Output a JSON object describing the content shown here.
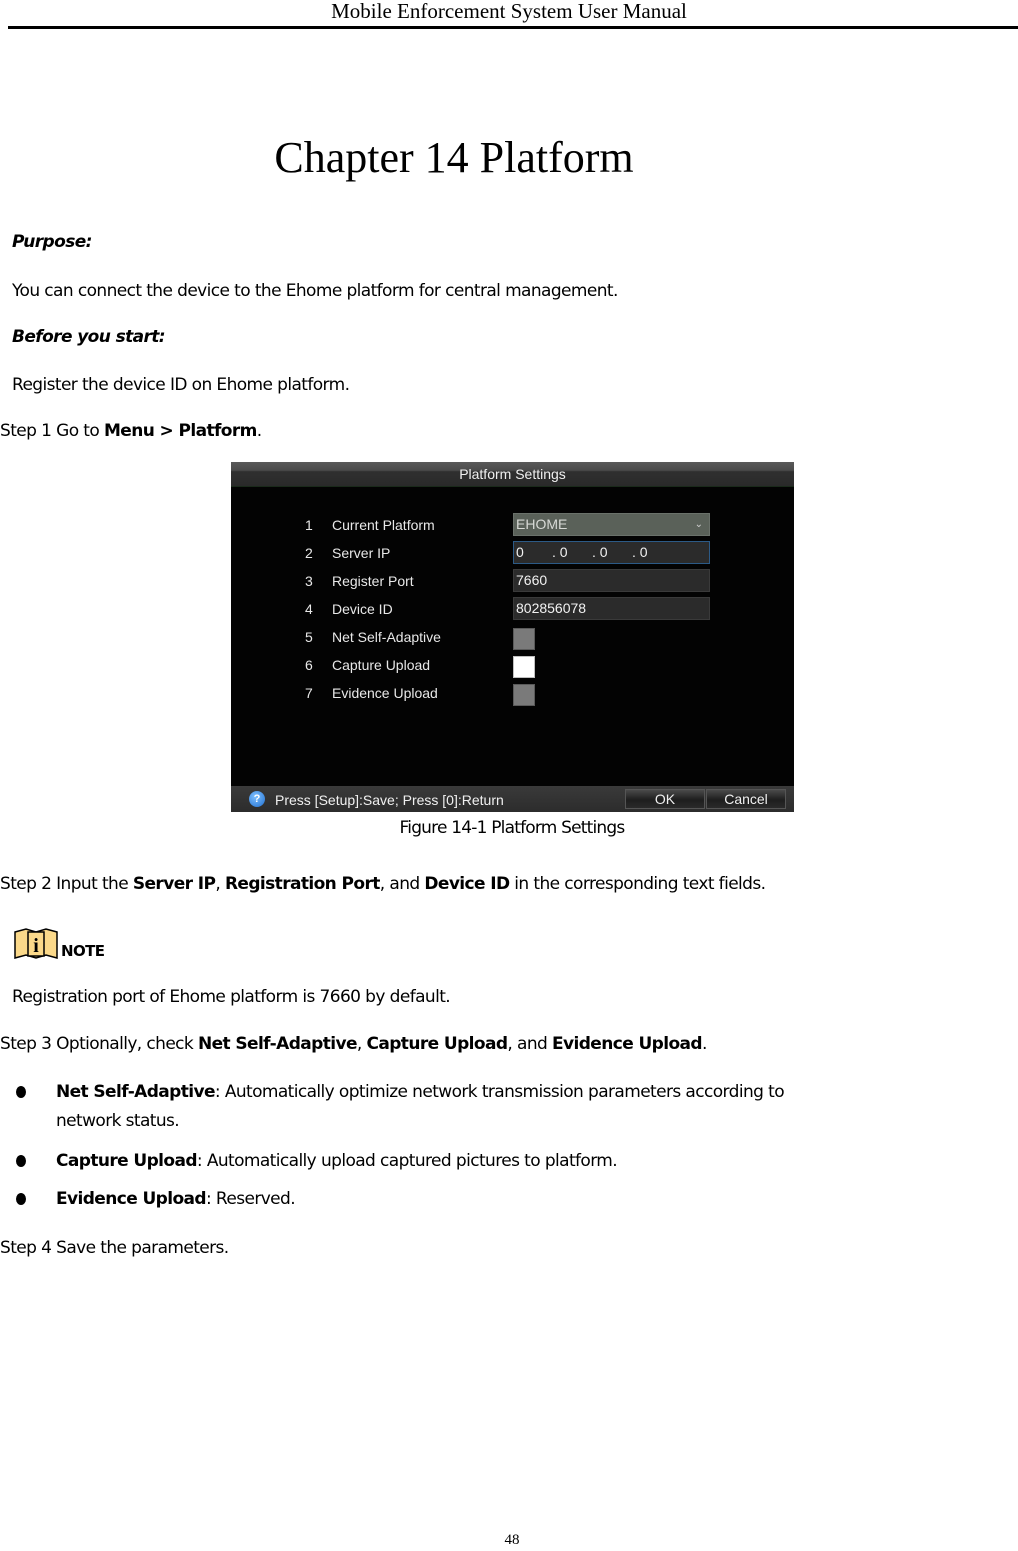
{
  "header": {
    "running_title": "Mobile Enforcement System User Manual"
  },
  "chapter": {
    "title": "Chapter 14 Platform"
  },
  "purpose": {
    "heading": "Purpose:",
    "text": "You can connect the device to the Ehome platform for central management."
  },
  "before_start": {
    "heading": "Before you start:",
    "text": "Register the device ID on Ehome platform."
  },
  "step1": {
    "prefix": "Step 1 Go to ",
    "bold": "Menu > Platform",
    "suffix": "."
  },
  "figure": {
    "window_title": "Platform Settings",
    "rows": [
      {
        "num": "1",
        "label": "Current Platform",
        "type": "select",
        "value": "EHOME"
      },
      {
        "num": "2",
        "label": "Server IP",
        "type": "ip",
        "value": [
          "0",
          ". 0",
          ". 0",
          ". 0"
        ]
      },
      {
        "num": "3",
        "label": "Register Port",
        "type": "text",
        "value": "7660"
      },
      {
        "num": "4",
        "label": "Device ID",
        "type": "text",
        "value": "802856078"
      },
      {
        "num": "5",
        "label": "Net Self-Adaptive",
        "type": "checkbox",
        "checked": false
      },
      {
        "num": "6",
        "label": "Capture Upload",
        "type": "checkbox",
        "checked": true
      },
      {
        "num": "7",
        "label": "Evidence Upload",
        "type": "checkbox",
        "checked": false
      }
    ],
    "footer_hint": "Press [Setup]:Save; Press [0]:Return",
    "ok_label": "OK",
    "cancel_label": "Cancel",
    "help_icon": "question-icon",
    "dropdown_icon": "chevron-down-icon",
    "caption": "Figure 14-1 Platform Settings"
  },
  "step2": {
    "prefix": "Step 2 Input the ",
    "b1": "Server IP",
    "sep1": ", ",
    "b2": "Registration Port",
    "sep2": ", and ",
    "b3": "Device ID",
    "suffix": " in the corresponding text fields."
  },
  "note": {
    "icon": "info-book-icon",
    "label": "NOTE",
    "text": "Registration port of Ehome platform is 7660 by default."
  },
  "step3": {
    "prefix": "Step 3 Optionally, check ",
    "b1": "Net Self-Adaptive",
    "sep1": ", ",
    "b2": "Capture Upload",
    "sep2": ", and ",
    "b3": "Evidence Upload",
    "suffix": "."
  },
  "bullets": [
    {
      "term": "Net Self-Adaptive",
      "line1": ": Automatically optimize network transmission parameters according to",
      "line2": "network status."
    },
    {
      "term": "Capture Upload",
      "line1": ": Automatically upload captured pictures to platform."
    },
    {
      "term": "Evidence Upload",
      "line1": ": Reserved."
    }
  ],
  "step4": {
    "text": "Step 4 Save the parameters."
  },
  "footer": {
    "page_number": "48"
  }
}
